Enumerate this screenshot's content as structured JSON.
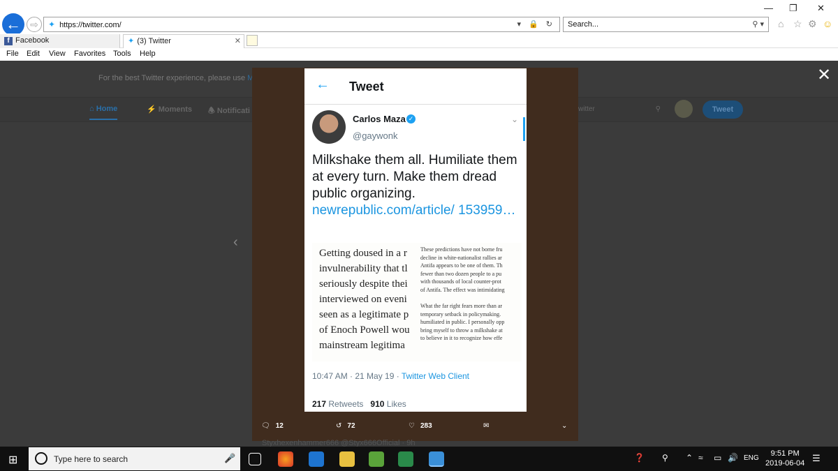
{
  "browser": {
    "url": "https://twitter.com/",
    "search_placeholder": "Search...",
    "tabs": [
      {
        "label": "Facebook"
      },
      {
        "label": "(3) Twitter"
      }
    ],
    "menu": [
      "File",
      "Edit",
      "View",
      "Favorites",
      "Tools",
      "Help"
    ]
  },
  "twitter_page": {
    "banner_text": "For the best Twitter experience, please use ",
    "banner_link": "M",
    "nav": {
      "home": "Home",
      "moments": "Moments",
      "notifications": "Notificati"
    },
    "search_placeholder": "witter",
    "tweet_button": "Tweet",
    "actions": {
      "replies": "12",
      "retweets": "72",
      "likes": "283"
    },
    "peek_user": "Styxhexenhammer666 @Styx666Official · 9h"
  },
  "tweet_screenshot": {
    "header_title": "Tweet",
    "name": "Carlos Maza",
    "handle": "@gaywonk",
    "text": "Milkshake them all. Humiliate them at every turn. Make them dread public organizing.",
    "link": "newrepublic.com/article/ 153959…",
    "time": "10:47 AM · 21 May 19 · ",
    "client": "Twitter Web Client",
    "retweets_count": "217",
    "retweets_label": "Retweets",
    "likes_count": "910",
    "likes_label": "Likes",
    "article_left": [
      "Getting doused in a r",
      "invulnerability that tl",
      "seriously despite thei",
      "interviewed on eveni",
      "seen as a legitimate p",
      "of Enoch Powell wou",
      "mainstream legitima"
    ],
    "article_right_1": [
      "These predictions have not borne fru",
      "decline in white-nationalist rallies ar",
      "Antifa appears to be one of them. Th",
      "fewer than two dozen people to a pu",
      "with thousands of local counter-prot",
      "of Antifa. The effect was intimidating"
    ],
    "article_right_2": [
      "What the far right fears more than ar",
      "temporary setback in policymaking.",
      "humiliated in public. I personally opp",
      "bring myself to throw a milkshake at",
      "to believe in it to recognize how effe"
    ]
  },
  "taskbar": {
    "search_text": "Type here to search",
    "lang": "ENG",
    "time": "9:51 PM",
    "date": "2019-06-04"
  }
}
